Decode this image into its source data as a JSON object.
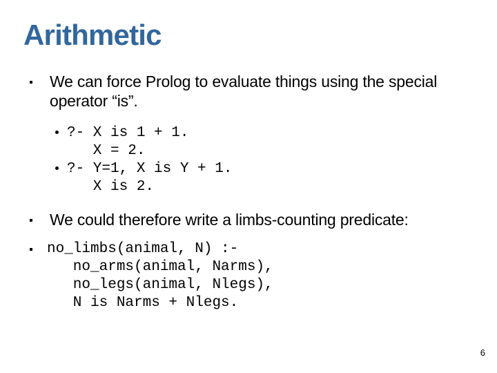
{
  "slide": {
    "title": "Arithmetic",
    "title_color": "#32679C",
    "background_color": "#FFFFFF",
    "text_color": "#000000",
    "page_number": "6",
    "bullets": [
      {
        "level": 1,
        "marker": "square-bullet",
        "style": "prose",
        "text": "We can force Prolog to evaluate things using the special operator “is”."
      },
      {
        "level": 2,
        "marker": "round-bullet",
        "style": "code",
        "text": "?- X is 1 + 1.\n   X = 2."
      },
      {
        "level": 2,
        "marker": "round-bullet",
        "style": "code",
        "text": "?- Y=1, X is Y + 1.\n   X is 2."
      },
      {
        "level": 1,
        "marker": "square-bullet",
        "style": "prose",
        "text": "We could therefore write a limbs-counting predicate:"
      },
      {
        "level": 1,
        "marker": "square-bullet",
        "style": "code",
        "text": "no_limbs(animal, N) :-\n   no_arms(animal, Narms),\n   no_legs(animal, Nlegs),\n   N is Narms + Nlegs."
      }
    ]
  }
}
